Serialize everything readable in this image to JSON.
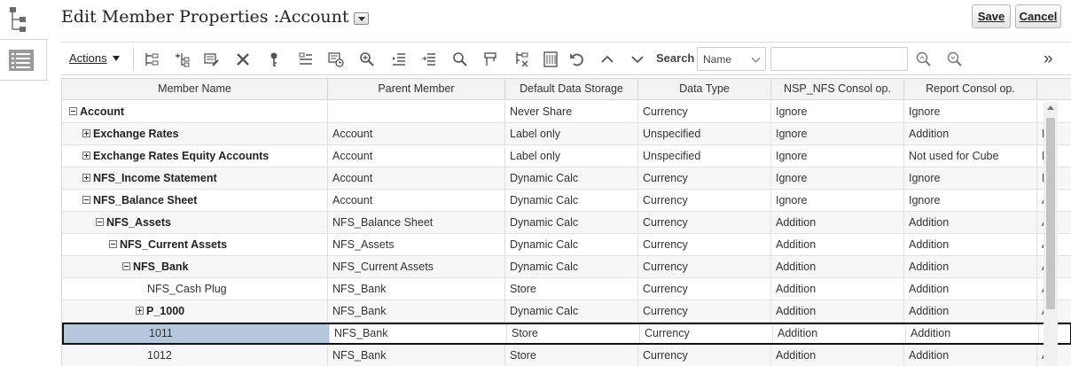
{
  "header": {
    "title": "Edit Member Properties :Account",
    "save_label": "Save",
    "cancel_label": "Cancel"
  },
  "toolbar": {
    "actions_label": "Actions",
    "search_label": "Search",
    "search_field": "Name",
    "search_value": "",
    "icons": [
      "add-sibling-icon",
      "add-child-icon",
      "edit-member-icon",
      "delete-icon",
      "key-icon",
      "properties-icon",
      "history-icon",
      "zoom-in-icon",
      "move-left-icon",
      "move-right-icon",
      "zoom-icon",
      "copy-icon",
      "clear-icon",
      "grid-icon",
      "undo-icon",
      "move-up-icon",
      "move-down-icon",
      "search-prev-icon",
      "search-next-icon"
    ],
    "overflow_icon": "double-chevron-right-icon"
  },
  "grid": {
    "columns": [
      "Member Name",
      "Parent Member",
      "Default Data Storage",
      "Data Type",
      "NSP_NFS Consol op.",
      "Report Consol op."
    ],
    "rows": [
      {
        "name": "Account",
        "level": 0,
        "expander": "minus",
        "bold": true,
        "parent": "",
        "storage": "Never Share",
        "type": "Currency",
        "nsp": "Ignore",
        "report": "Ignore",
        "extra": ""
      },
      {
        "name": "Exchange Rates",
        "level": 1,
        "expander": "plus",
        "bold": true,
        "parent": "Account",
        "storage": "Label only",
        "type": "Unspecified",
        "nsp": "Ignore",
        "report": "Addition",
        "extra": "F"
      },
      {
        "name": "Exchange Rates Equity Accounts",
        "level": 1,
        "expander": "plus",
        "bold": true,
        "parent": "Account",
        "storage": "Label only",
        "type": "Unspecified",
        "nsp": "Ignore",
        "report": "Not used for Cube",
        "extra": "F"
      },
      {
        "name": "NFS_Income Statement",
        "level": 1,
        "expander": "plus",
        "bold": true,
        "parent": "Account",
        "storage": "Dynamic Calc",
        "type": "Currency",
        "nsp": "Ignore",
        "report": "Ignore",
        "extra": "F"
      },
      {
        "name": "NFS_Balance Sheet",
        "level": 1,
        "expander": "minus",
        "bold": true,
        "parent": "Account",
        "storage": "Dynamic Calc",
        "type": "Currency",
        "nsp": "Ignore",
        "report": "Ignore",
        "extra": "A"
      },
      {
        "name": "NFS_Assets",
        "level": 2,
        "expander": "minus",
        "bold": true,
        "parent": "NFS_Balance Sheet",
        "storage": "Dynamic Calc",
        "type": "Currency",
        "nsp": "Addition",
        "report": "Addition",
        "extra": "A"
      },
      {
        "name": "NFS_Current Assets",
        "level": 3,
        "expander": "minus",
        "bold": true,
        "parent": "NFS_Assets",
        "storage": "Dynamic Calc",
        "type": "Currency",
        "nsp": "Addition",
        "report": "Addition",
        "extra": "A"
      },
      {
        "name": "NFS_Bank",
        "level": 4,
        "expander": "minus",
        "bold": true,
        "parent": "NFS_Current Assets",
        "storage": "Dynamic Calc",
        "type": "Currency",
        "nsp": "Addition",
        "report": "Addition",
        "extra": "A"
      },
      {
        "name": "NFS_Cash Plug",
        "level": 5,
        "expander": "",
        "bold": false,
        "parent": "NFS_Bank",
        "storage": "Store",
        "type": "Currency",
        "nsp": "Addition",
        "report": "Addition",
        "extra": "A"
      },
      {
        "name": "P_1000",
        "level": 5,
        "expander": "plus",
        "bold": true,
        "parent": "NFS_Bank",
        "storage": "Dynamic Calc",
        "type": "Currency",
        "nsp": "Addition",
        "report": "Addition",
        "extra": "A"
      },
      {
        "name": "1011",
        "level": 5,
        "expander": "",
        "bold": false,
        "selected": true,
        "parent": "NFS_Bank",
        "storage": "Store",
        "type": "Currency",
        "nsp": "Addition",
        "report": "Addition",
        "extra": "A"
      },
      {
        "name": "1012",
        "level": 5,
        "expander": "",
        "bold": false,
        "parent": "NFS_Bank",
        "storage": "Store",
        "type": "Currency",
        "nsp": "Addition",
        "report": "Addition",
        "extra": "A"
      }
    ]
  }
}
